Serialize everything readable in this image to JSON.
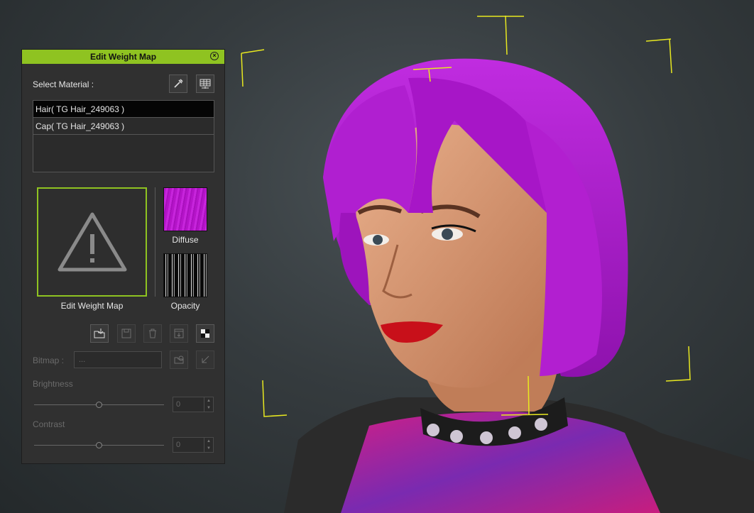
{
  "panel": {
    "title": "Edit Weight Map",
    "select_material_label": "Select Material :",
    "materials": [
      {
        "label": "Hair( TG Hair_249063 )",
        "selected": true
      },
      {
        "label": "Cap( TG Hair_249063 )",
        "selected": false
      }
    ],
    "weight_map_caption": "Edit Weight Map",
    "diffuse_caption": "Diffuse",
    "opacity_caption": "Opacity",
    "bitmap_label": "Bitmap :",
    "bitmap_value": "...",
    "brightness_label": "Brightness",
    "brightness_value": "0",
    "brightness_level": 0.5,
    "contrast_label": "Contrast",
    "contrast_value": "0",
    "contrast_level": 0.5
  },
  "colors": {
    "accent": "#8fc321",
    "hair": "#b21fd0",
    "gizmo": "#e8e820"
  }
}
